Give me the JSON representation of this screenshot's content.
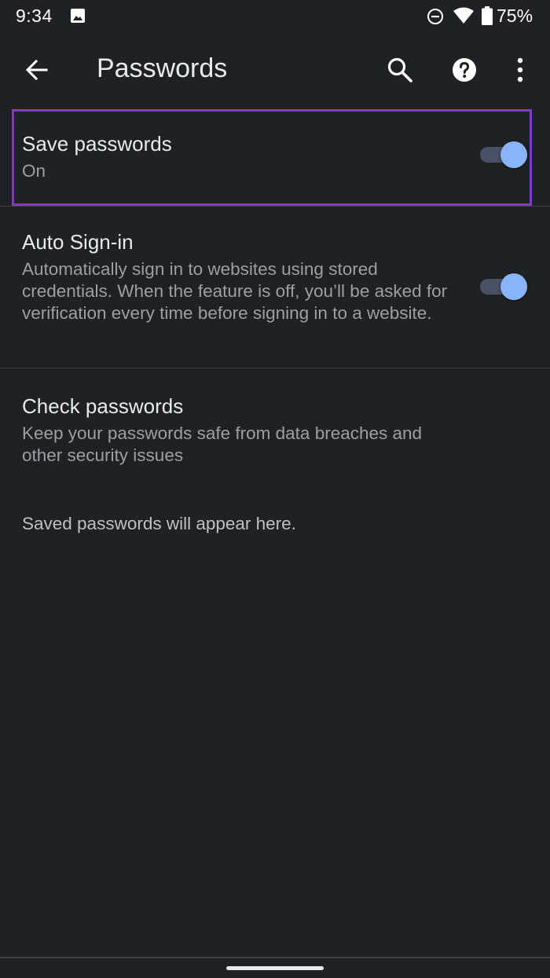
{
  "status_bar": {
    "time": "9:34",
    "battery_percent": "75%",
    "icons": [
      "gallery-icon",
      "do-not-disturb-icon",
      "wifi-icon",
      "battery-icon"
    ]
  },
  "toolbar": {
    "title": "Passwords",
    "icons": [
      "back-arrow-icon",
      "search-icon",
      "help-icon",
      "more-vert-icon"
    ]
  },
  "settings": {
    "save_passwords": {
      "title": "Save passwords",
      "summary": "On",
      "enabled": true
    },
    "auto_signin": {
      "title": "Auto Sign-in",
      "summary": "Automatically sign in to websites using stored credentials. When the feature is off, you’ll be asked for verification every time before signing in to a website.",
      "enabled": true
    },
    "check_passwords": {
      "title": "Check passwords",
      "summary": "Keep your passwords safe from data breaches and other security issues"
    }
  },
  "empty_state": {
    "text": "Saved passwords will appear here."
  },
  "colors": {
    "background": "#202124",
    "accent": "#8ab4f8",
    "highlight_border": "#7e3bbf"
  }
}
